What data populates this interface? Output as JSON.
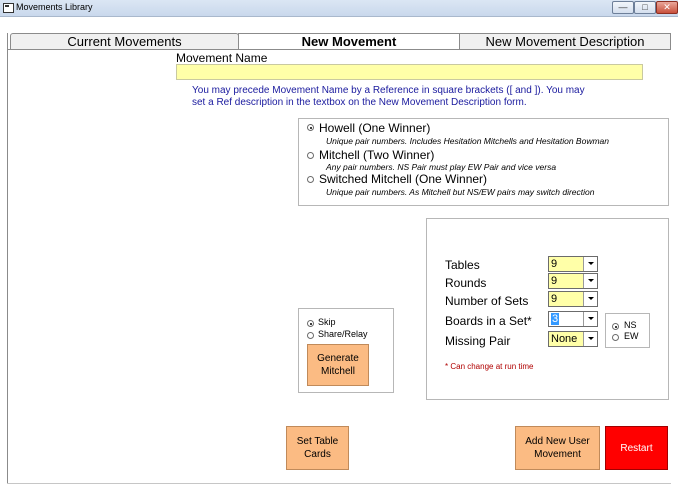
{
  "window": {
    "title": "Movements Library",
    "min_label": "—",
    "max_label": "□",
    "close_label": "✕"
  },
  "tabs": [
    {
      "label": "Current Movements"
    },
    {
      "label": "New Movement"
    },
    {
      "label": "New Movement Description"
    }
  ],
  "form": {
    "movement_name_label": "Movement Name",
    "movement_name_value": "",
    "info_line1": "You may precede Movement Name by a Reference in square brackets ([ and ]). You may",
    "info_line2": "set a Ref description in the textbox on the New Movement Description form."
  },
  "movement_types": [
    {
      "label": "Howell (One Winner)",
      "description": "Unique pair numbers. Includes Hesitation Mitchells and Hesitation Bowman",
      "selected": true
    },
    {
      "label": "Mitchell (Two Winner)",
      "description": "Any pair numbers. NS Pair must play EW Pair and vice versa",
      "selected": false
    },
    {
      "label": "Switched Mitchell (One Winner)",
      "description": "Unique pair numbers. As Mitchell but NS/EW pairs may switch direction",
      "selected": false
    }
  ],
  "mitchell_options": {
    "skip_label": "Skip",
    "share_label": "Share/Relay",
    "generate_label_1": "Generate",
    "generate_label_2": "Mitchell"
  },
  "settings": {
    "tables_label": "Tables",
    "tables_value": "9",
    "rounds_label": "Rounds",
    "rounds_value": "9",
    "sets_label": "Number of Sets",
    "sets_value": "9",
    "boards_label": "Boards in a Set*",
    "boards_value": "3",
    "missing_label": "Missing Pair",
    "missing_value": "None",
    "ns_label": "NS",
    "ew_label": "EW",
    "note": "* Can change at run time"
  },
  "buttons": {
    "set_table_1": "Set Table",
    "set_table_2": "Cards",
    "add_new_1": "Add New User",
    "add_new_2": "Movement",
    "restart": "Restart"
  }
}
